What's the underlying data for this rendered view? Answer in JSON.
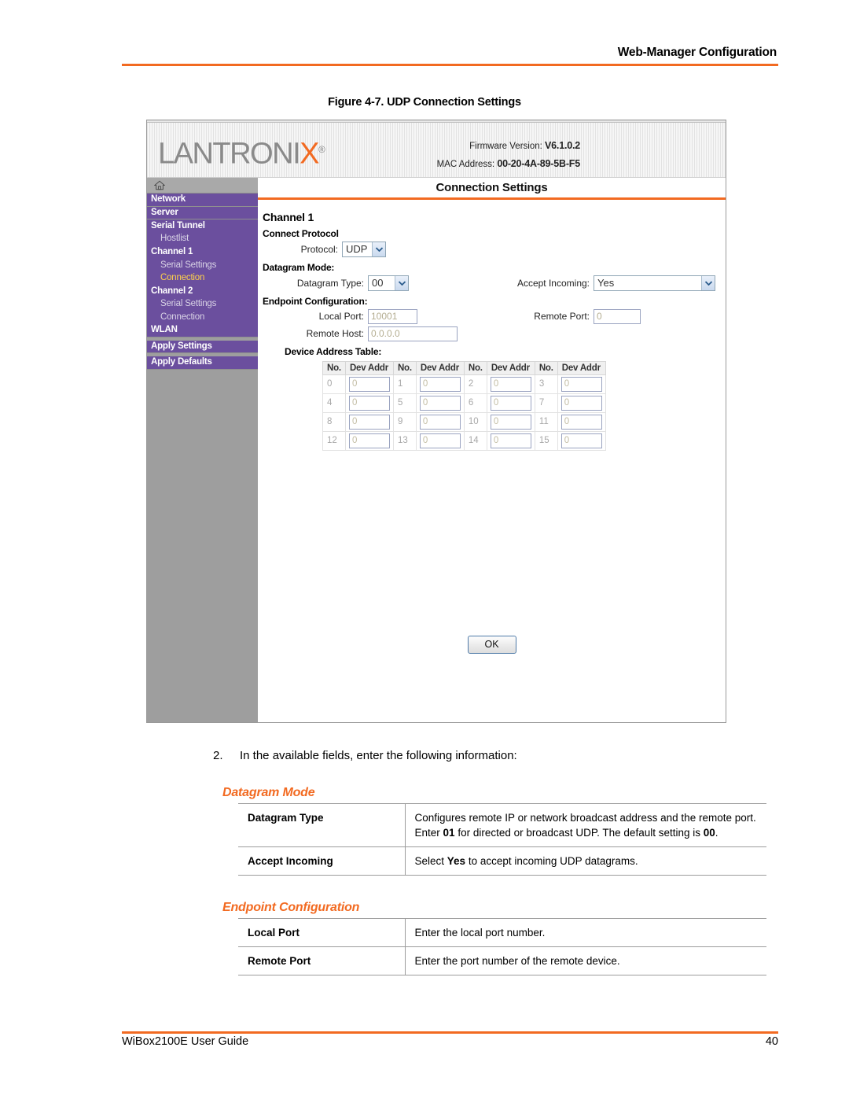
{
  "page": {
    "header_title": "Web-Manager Configuration",
    "figure_caption": "Figure 4-7. UDP Connection Settings",
    "step_number": "2.",
    "step_text": "In the available fields, enter the following information:",
    "footer_left": "WiBox2100E User Guide",
    "footer_page": "40",
    "accent_color": "#F26A21"
  },
  "screenshot": {
    "brand": {
      "logo_main": "LANTRONI",
      "logo_accent": "X",
      "logo_reg": "®",
      "firmware_label": "Firmware Version:",
      "firmware_value": "V6.1.0.2",
      "mac_label": "MAC Address:",
      "mac_value": "00-20-4A-89-5B-F5"
    },
    "sidebar": {
      "home_icon": "home-icon",
      "items": [
        {
          "label": "Network",
          "level": "top",
          "active": false
        },
        {
          "label": "Server",
          "level": "top",
          "active": false
        },
        {
          "label": "Serial Tunnel",
          "level": "top",
          "active": false
        },
        {
          "label": "Hostlist",
          "level": "sub",
          "active": false
        },
        {
          "label": "Channel 1",
          "level": "top",
          "active": false
        },
        {
          "label": "Serial Settings",
          "level": "sub",
          "active": false
        },
        {
          "label": "Connection",
          "level": "sub",
          "active": true
        },
        {
          "label": "Channel 2",
          "level": "top",
          "active": false
        },
        {
          "label": "Serial Settings",
          "level": "sub",
          "active": false
        },
        {
          "label": "Connection",
          "level": "sub",
          "active": false
        },
        {
          "label": "WLAN",
          "level": "top",
          "active": false
        },
        {
          "label": "Apply Settings",
          "level": "top",
          "active": false
        },
        {
          "label": "Apply Defaults",
          "level": "top",
          "active": false
        }
      ]
    },
    "content": {
      "title": "Connection Settings",
      "channel_heading": "Channel 1",
      "connect_protocol_heading": "Connect Protocol",
      "protocol_label": "Protocol:",
      "protocol_value": "UDP",
      "datagram_mode_heading": "Datagram Mode:",
      "datagram_type_label": "Datagram Type:",
      "datagram_type_value": "00",
      "accept_incoming_label": "Accept Incoming:",
      "accept_incoming_value": "Yes",
      "endpoint_heading": "Endpoint Configuration:",
      "local_port_label": "Local Port:",
      "local_port_value": "10001",
      "remote_port_label": "Remote Port:",
      "remote_port_value": "0",
      "remote_host_label": "Remote Host:",
      "remote_host_value": "0.0.0.0",
      "device_table_heading": "Device Address Table:",
      "device_table": {
        "headers": [
          "No.",
          "Dev Addr",
          "No.",
          "Dev Addr",
          "No.",
          "Dev Addr",
          "No.",
          "Dev Addr"
        ],
        "rows": [
          [
            {
              "no": "0",
              "addr": "0"
            },
            {
              "no": "1",
              "addr": "0"
            },
            {
              "no": "2",
              "addr": "0"
            },
            {
              "no": "3",
              "addr": "0"
            }
          ],
          [
            {
              "no": "4",
              "addr": "0"
            },
            {
              "no": "5",
              "addr": "0"
            },
            {
              "no": "6",
              "addr": "0"
            },
            {
              "no": "7",
              "addr": "0"
            }
          ],
          [
            {
              "no": "8",
              "addr": "0"
            },
            {
              "no": "9",
              "addr": "0"
            },
            {
              "no": "10",
              "addr": "0"
            },
            {
              "no": "11",
              "addr": "0"
            }
          ],
          [
            {
              "no": "12",
              "addr": "0"
            },
            {
              "no": "13",
              "addr": "0"
            },
            {
              "no": "14",
              "addr": "0"
            },
            {
              "no": "15",
              "addr": "0"
            }
          ]
        ]
      },
      "ok_label": "OK"
    }
  },
  "doc_sections": [
    {
      "heading": "Datagram Mode",
      "rows": [
        {
          "key": "Datagram Type",
          "value_parts": [
            {
              "t": "Configures remote IP or network broadcast address and the remote port. Enter ",
              "b": false
            },
            {
              "t": "01",
              "b": true
            },
            {
              "t": " for directed or broadcast UDP. The default setting is ",
              "b": false
            },
            {
              "t": "00",
              "b": true
            },
            {
              "t": ".",
              "b": false
            }
          ]
        },
        {
          "key": "Accept Incoming",
          "value_parts": [
            {
              "t": "Select ",
              "b": false
            },
            {
              "t": "Yes",
              "b": true
            },
            {
              "t": " to accept incoming UDP datagrams.",
              "b": false
            }
          ]
        }
      ]
    },
    {
      "heading": "Endpoint Configuration",
      "rows": [
        {
          "key": "Local Port",
          "value_parts": [
            {
              "t": "Enter the local port number.",
              "b": false
            }
          ]
        },
        {
          "key": "Remote Port",
          "value_parts": [
            {
              "t": "Enter the port number of the remote device.",
              "b": false
            }
          ]
        }
      ]
    }
  ]
}
